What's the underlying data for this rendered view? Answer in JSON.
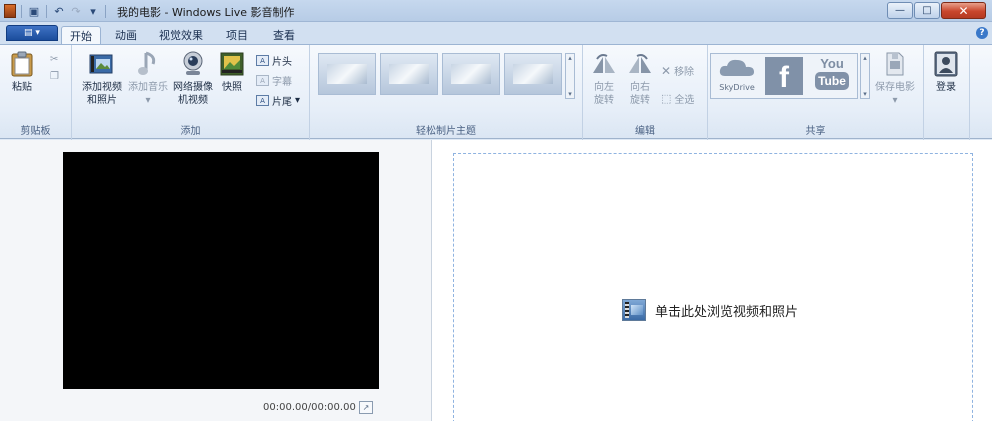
{
  "window": {
    "title": "我的电影 - Windows Live 影音制作",
    "controls": {
      "minimize": "—",
      "maximize": "□",
      "close": "✕"
    }
  },
  "quick_access": {
    "save_icon": "save-icon",
    "undo_icon": "undo-icon",
    "redo_icon": "redo-icon",
    "dropdown": "▾"
  },
  "tabs": [
    {
      "label": "开始",
      "active": true
    },
    {
      "label": "动画",
      "active": false
    },
    {
      "label": "视觉效果",
      "active": false
    },
    {
      "label": "项目",
      "active": false
    },
    {
      "label": "查看",
      "active": false
    }
  ],
  "help_label": "?",
  "ribbon": {
    "clipboard": {
      "paste": "粘贴",
      "label": "剪贴板"
    },
    "add": {
      "add_videos_line1": "添加视频",
      "add_videos_line2": "和照片",
      "add_music": "添加音乐",
      "webcam_line1": "网络摄像",
      "webcam_line2": "机视频",
      "snapshot": "快照",
      "title": "片头",
      "caption": "字幕",
      "credits": "片尾",
      "label": "添加"
    },
    "themes": {
      "label": "轻松制片主题"
    },
    "edit": {
      "rotate_left_line1": "向左",
      "rotate_left_line2": "旋转",
      "rotate_right_line1": "向右",
      "rotate_right_line2": "旋转",
      "remove": "移除",
      "select_all": "全选",
      "label": "编辑"
    },
    "share": {
      "skydrive": "SkyDrive",
      "facebook": "f",
      "youtube_top": "You",
      "youtube_bottom": "Tube",
      "save_movie": "保存电影",
      "label": "共享"
    },
    "signin": {
      "label": "登录"
    }
  },
  "preview": {
    "timecode": "00:00.00/00:00.00"
  },
  "storyboard": {
    "browse_text": "单击此处浏览视频和照片"
  },
  "colors": {
    "accent": "#1b4d9c",
    "ribbon_bg": "#e6eef8",
    "storyboard_border": "#8fb3e0"
  }
}
